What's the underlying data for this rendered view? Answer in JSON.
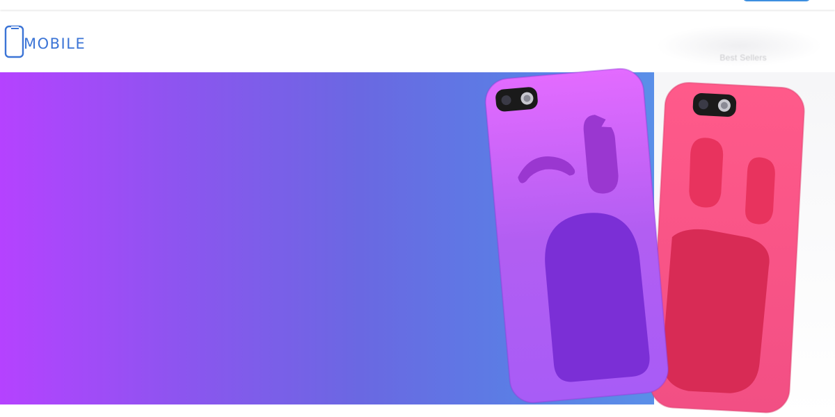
{
  "header": {
    "logo_text": "MOBILE",
    "nav_item": "Best Sellers"
  },
  "colors": {
    "brand_blue": "#3b74d6",
    "banner_start": "#b542ff",
    "banner_end": "#5a8fe8",
    "case_purple": "#b35cf0",
    "case_pink": "#f2507e"
  },
  "icons": {
    "logo": "phone-outline-icon"
  },
  "banner": {
    "products": [
      "purple-winking-face-phone-case",
      "pink-surprised-face-phone-case"
    ]
  }
}
